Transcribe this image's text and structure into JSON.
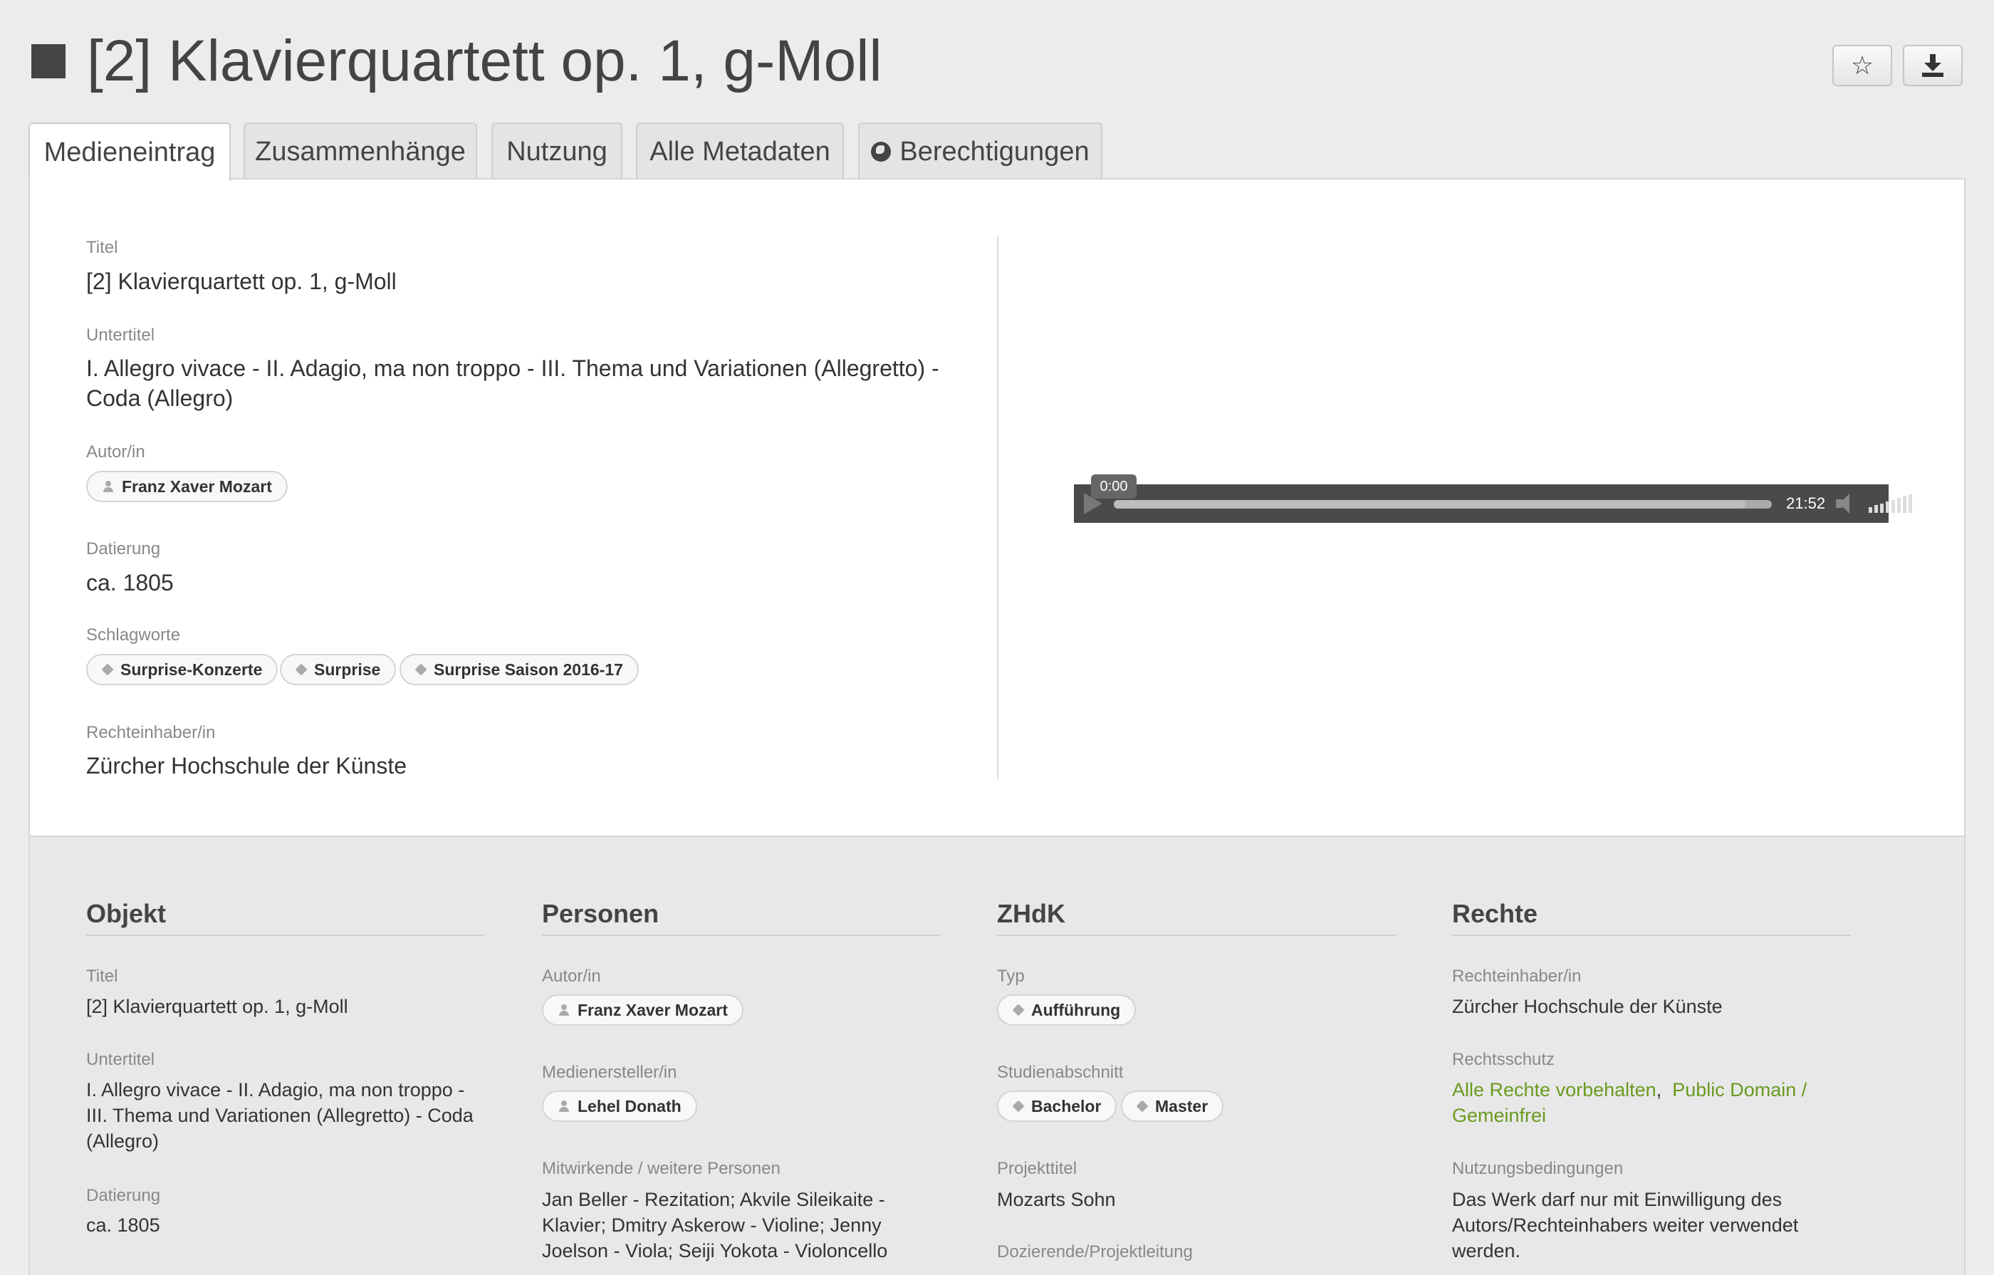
{
  "header": {
    "title": "[2] Klavierquartett op. 1, g-Moll",
    "favorite_icon": "star-icon",
    "download_icon": "download-icon"
  },
  "tabs": [
    {
      "label": "Medieneintrag",
      "active": true
    },
    {
      "label": "Zusammenhänge",
      "active": false
    },
    {
      "label": "Nutzung",
      "active": false
    },
    {
      "label": "Alle Metadaten",
      "active": false
    },
    {
      "label": "Berechtigungen",
      "active": false,
      "icon": "globe-icon"
    }
  ],
  "summary": {
    "title_label": "Titel",
    "title_value": "[2] Klavierquartett op. 1, g-Moll",
    "subtitle_label": "Untertitel",
    "subtitle_value": "I. Allegro vivace - II. Adagio, ma non troppo - III. Thema und Variationen (Allegretto) - Coda (Allegro)",
    "author_label": "Autor/in",
    "author": "Franz Xaver Mozart",
    "date_label": "Datierung",
    "date_value": "ca. 1805",
    "keywords_label": "Schlagworte",
    "keywords": [
      "Surprise-Konzerte",
      "Surprise",
      "Surprise Saison 2016-17"
    ],
    "rightsholder_label": "Rechteinhaber/in",
    "rightsholder_value": "Zürcher Hochschule der Künste"
  },
  "player": {
    "current_time": "0:00",
    "duration": "21:52",
    "buffered_fraction": 0.96,
    "volume_fraction": 1.0
  },
  "sections": {
    "objekt": {
      "heading": "Objekt",
      "title_label": "Titel",
      "title_value": "[2] Klavierquartett op. 1, g-Moll",
      "subtitle_label": "Untertitel",
      "subtitle_value": "I. Allegro vivace - II. Adagio, ma non troppo - III. Thema und Variationen (Allegretto) - Coda (Allegro)",
      "date_label": "Datierung",
      "date_value": "ca. 1805"
    },
    "personen": {
      "heading": "Personen",
      "author_label": "Autor/in",
      "author": "Franz Xaver Mozart",
      "creator_label": "Medienersteller/in",
      "creator": "Lehel Donath",
      "contributors_label": "Mitwirkende / weitere Personen",
      "contributors_value": "Jan Beller - Rezitation; Akvile Sileikaite - Klavier; Dmitry Askerow - Violine; Jenny Joelson - Viola; Seiji Yokota - Violoncello"
    },
    "zhdk": {
      "heading": "ZHdK",
      "type_label": "Typ",
      "type": "Aufführung",
      "study_label": "Studienabschnitt",
      "study": [
        "Bachelor",
        "Master"
      ],
      "project_label": "Projekttitel",
      "project_value": "Mozarts Sohn",
      "lecturer_label": "Dozierende/Projektleitung"
    },
    "rechte": {
      "heading": "Rechte",
      "holder_label": "Rechteinhaber/in",
      "holder_value": "Zürcher Hochschule der Künste",
      "protection_label": "Rechtsschutz",
      "protection_1": "Alle Rechte vorbehalten",
      "protection_sep": ",",
      "protection_2": "Public Domain / Gemeinfrei",
      "terms_label": "Nutzungsbedingungen",
      "terms_value": "Das Werk darf nur mit Einwilligung des Autors/Rechteinhabers weiter verwendet werden."
    }
  },
  "colors": {
    "link_green": "#6a9a1f",
    "player_bg": "#4a4a4a"
  }
}
